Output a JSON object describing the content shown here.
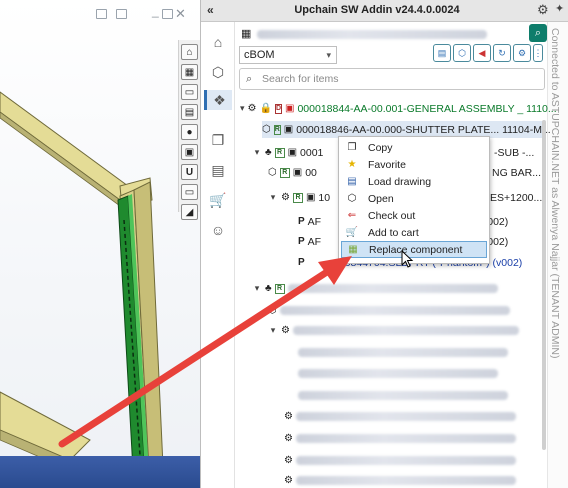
{
  "window": {
    "title": "Upchain SW Addin v24.4.0.0024",
    "collapse_icon": "«",
    "settings_icon": "gear-icon",
    "pin_icon": "pin-icon"
  },
  "vertical_label": "Connected to ASTUPCHAIN.NET as Alwenya Najjar (TENANT ADMIN)",
  "context_bar": {
    "placeholder_text": ""
  },
  "bom_select": {
    "value": "cBOM"
  },
  "search": {
    "placeholder": "Search for items"
  },
  "tree": {
    "root": "000018844-AA-00.001-GENERAL ASSEMBLY _ 1110...",
    "child1": "000018846-AA-00.000-SHUTTER PLATE... 11104-M...",
    "child2_prefix": "0001",
    "child2_suffix": "-SUB -...",
    "child3_prefix": "00",
    "child3_suffix": "NG BAR...",
    "child4_prefix": "10",
    "child4_suffix": "ES+1200...",
    "child5_prefix": "AF",
    "child5_suffix": "v002)",
    "child6_prefix": "AF",
    "child6_suffix": "v002)",
    "child7": "6844704.SLDPRT (*Phantom*) (v002)"
  },
  "context_menu": {
    "items": [
      {
        "label": "Copy",
        "icon": "copy-icon"
      },
      {
        "label": "Favorite",
        "icon": "star-icon"
      },
      {
        "label": "Load drawing",
        "icon": "drawing-icon"
      },
      {
        "label": "Open",
        "icon": "open-icon"
      },
      {
        "label": "Check out",
        "icon": "checkout-icon"
      },
      {
        "label": "Add to cart",
        "icon": "cart-icon"
      },
      {
        "label": "Replace component",
        "icon": "replace-icon"
      }
    ],
    "highlighted_index": 6
  },
  "colors": {
    "accent_teal": "#0e7d6b",
    "arrow_red": "#e8413a",
    "item_green": "#0a7a2a",
    "highlight": "#cfe3f5",
    "frame_yellow": "#e2d991",
    "frame_green": "#2a9a3a"
  }
}
